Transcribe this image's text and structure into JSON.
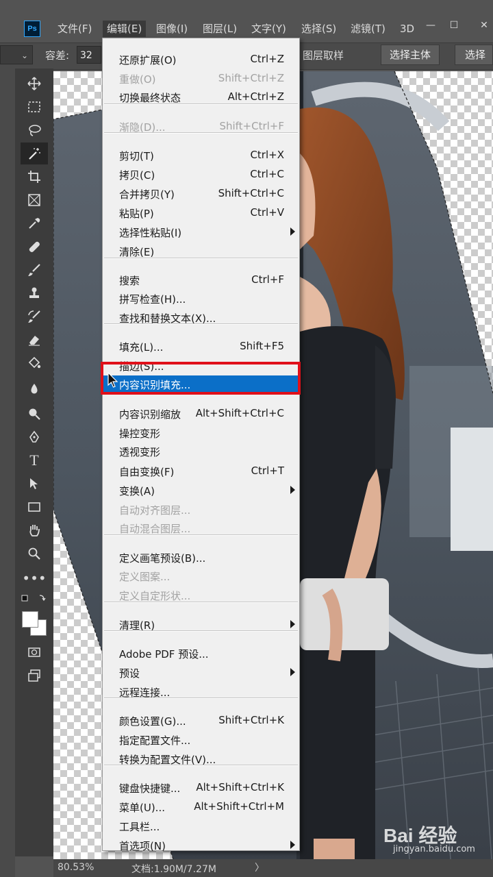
{
  "app": {
    "logo": "Ps"
  },
  "menubar": {
    "items": [
      "文件(F)",
      "编辑(E)",
      "图像(I)",
      "图层(L)",
      "文字(Y)",
      "选择(S)",
      "滤镜(T)",
      "3D"
    ],
    "window_controls": [
      "—",
      "☐",
      "✕"
    ]
  },
  "options": {
    "tolerance_label": "容差:",
    "tolerance_value": "32",
    "sample_all_layers": "图层取样",
    "select_subject": "选择主体",
    "select_and_mask": "选择并"
  },
  "tools": [
    "move-icon",
    "marquee-icon",
    "lasso-icon",
    "magic-wand-icon",
    "crop-icon",
    "frame-icon",
    "eyedropper-icon",
    "healing-icon",
    "brush-icon",
    "stamp-icon",
    "history-brush-icon",
    "eraser-icon",
    "paint-bucket-icon",
    "blur-icon",
    "dodge-icon",
    "pen-icon",
    "type-icon",
    "path-select-icon",
    "rectangle-icon",
    "hand-icon",
    "zoom-icon",
    "more-icon"
  ],
  "edit_menu": {
    "groups": [
      [
        {
          "label": "还原扩展(O)",
          "shortcut": "Ctrl+Z",
          "disabled": false
        },
        {
          "label": "重做(O)",
          "shortcut": "Shift+Ctrl+Z",
          "disabled": true
        },
        {
          "label": "切换最终状态",
          "shortcut": "Alt+Ctrl+Z",
          "disabled": false
        }
      ],
      [
        {
          "label": "渐隐(D)...",
          "shortcut": "Shift+Ctrl+F",
          "disabled": true
        }
      ],
      [
        {
          "label": "剪切(T)",
          "shortcut": "Ctrl+X",
          "disabled": false
        },
        {
          "label": "拷贝(C)",
          "shortcut": "Ctrl+C",
          "disabled": false
        },
        {
          "label": "合并拷贝(Y)",
          "shortcut": "Shift+Ctrl+C",
          "disabled": false
        },
        {
          "label": "粘贴(P)",
          "shortcut": "Ctrl+V",
          "disabled": false
        },
        {
          "label": "选择性粘贴(I)",
          "shortcut": "",
          "submenu": true,
          "disabled": false
        },
        {
          "label": "清除(E)",
          "shortcut": "",
          "disabled": false
        }
      ],
      [
        {
          "label": "搜索",
          "shortcut": "Ctrl+F",
          "disabled": false
        },
        {
          "label": "拼写检查(H)...",
          "shortcut": "",
          "disabled": false
        },
        {
          "label": "查找和替换文本(X)...",
          "shortcut": "",
          "disabled": false
        }
      ],
      [
        {
          "label": "填充(L)...",
          "shortcut": "Shift+F5",
          "disabled": false
        },
        {
          "label": "描边(S)...",
          "shortcut": "",
          "disabled": false
        },
        {
          "label": "内容识别填充...",
          "shortcut": "",
          "disabled": false,
          "highlight": true
        },
        {
          "label": "内容识别缩放",
          "shortcut": "Alt+Shift+Ctrl+C",
          "disabled": false
        },
        {
          "label": "操控变形",
          "shortcut": "",
          "disabled": false
        },
        {
          "label": "透视变形",
          "shortcut": "",
          "disabled": false
        },
        {
          "label": "自由变换(F)",
          "shortcut": "Ctrl+T",
          "disabled": false
        },
        {
          "label": "变换(A)",
          "shortcut": "",
          "submenu": true,
          "disabled": false
        },
        {
          "label": "自动对齐图层...",
          "shortcut": "",
          "disabled": true
        },
        {
          "label": "自动混合图层...",
          "shortcut": "",
          "disabled": true
        }
      ],
      [
        {
          "label": "定义画笔预设(B)...",
          "shortcut": "",
          "disabled": false
        },
        {
          "label": "定义图案...",
          "shortcut": "",
          "disabled": true
        },
        {
          "label": "定义自定形状...",
          "shortcut": "",
          "disabled": true
        }
      ],
      [
        {
          "label": "清理(R)",
          "shortcut": "",
          "submenu": true,
          "disabled": false
        }
      ],
      [
        {
          "label": "Adobe PDF 预设...",
          "shortcut": "",
          "disabled": false
        },
        {
          "label": "预设",
          "shortcut": "",
          "submenu": true,
          "disabled": false
        },
        {
          "label": "远程连接...",
          "shortcut": "",
          "disabled": false
        }
      ],
      [
        {
          "label": "颜色设置(G)...",
          "shortcut": "Shift+Ctrl+K",
          "disabled": false
        },
        {
          "label": "指定配置文件...",
          "shortcut": "",
          "disabled": false
        },
        {
          "label": "转换为配置文件(V)...",
          "shortcut": "",
          "disabled": false
        }
      ],
      [
        {
          "label": "键盘快捷键...",
          "shortcut": "Alt+Shift+Ctrl+K",
          "disabled": false
        },
        {
          "label": "菜单(U)...",
          "shortcut": "Alt+Shift+Ctrl+M",
          "disabled": false
        },
        {
          "label": "工具栏...",
          "shortcut": "",
          "disabled": false
        },
        {
          "label": "首选项(N)",
          "shortcut": "",
          "submenu": true,
          "disabled": false
        }
      ]
    ]
  },
  "status": {
    "zoom": "80.53%",
    "doc": "文档:1.90M/7.27M",
    "arrow": "〉"
  },
  "watermark": {
    "brand": "Bai 经验",
    "url": "jingyan.baidu.com"
  },
  "colors": {
    "highlight": "#0b6fc8",
    "annotation": "#e0101a"
  }
}
